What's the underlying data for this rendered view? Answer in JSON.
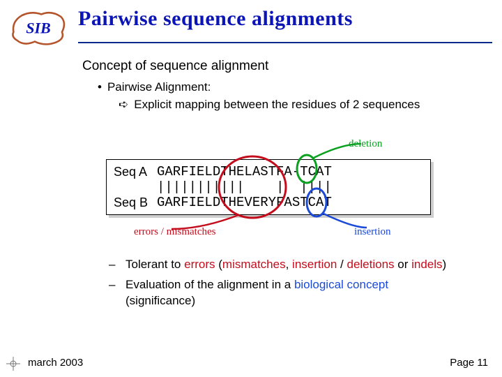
{
  "logo_text": "SIB",
  "title": "Pairwise sequence alignments",
  "section_heading": "Concept of sequence alignment",
  "bullet_main": "Pairwise Alignment:",
  "bullet_sub": "Explicit mapping between the residues of 2 sequences",
  "annotations": {
    "deletion": "deletion",
    "errors": "errors / mismatches",
    "insertion": "insertion"
  },
  "alignment": {
    "seqA_label": "Seq A",
    "seqA_seq": "GARFIELDTHELASTFA-TCAT",
    "match_row": "|||||||||||    |  ||||",
    "seqB_label": "Seq B",
    "seqB_seq": "GARFIELDTHEVERYFASTCAT"
  },
  "lower_points": {
    "p1_pre": "Tolerant to ",
    "p1_err": "errors",
    "p1_mid1": " (",
    "p1_mm": "mismatches",
    "p1_mid2": ", ",
    "p1_ins": "insertion",
    "p1_mid3": " / ",
    "p1_del": "deletions",
    "p1_mid4": " or ",
    "p1_indel": "indels",
    "p1_end": ")",
    "p2_pre": "Evaluation of the alignment in a ",
    "p2_bio": "biological concept",
    "p2_end": " (significance)"
  },
  "footer": {
    "date": "march 2003",
    "page": "Page 11"
  }
}
